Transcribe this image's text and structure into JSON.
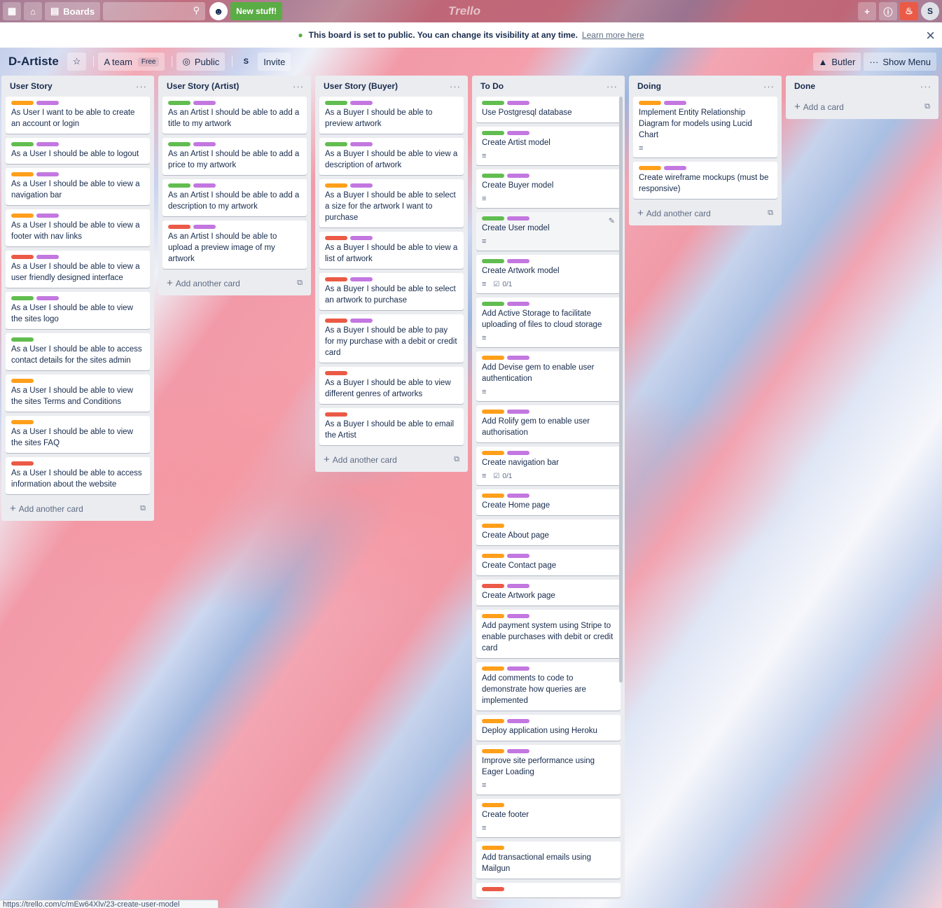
{
  "topbar": {
    "boards_label": "Boards",
    "new_stuff_label": "New stuff!",
    "logo_text": "Trello",
    "avatar_initial": "S",
    "icons": [
      "apps-icon",
      "home-icon",
      "boards-icon",
      "search-icon",
      "plus-icon",
      "info-icon",
      "bell-icon"
    ]
  },
  "banner": {
    "message": "This board is set to public. You can change its visibility at any time.",
    "link": "Learn more here"
  },
  "board_header": {
    "title": "D-Artiste",
    "team": "A team",
    "team_badge": "Free",
    "visibility": "Public",
    "member_initial": "S",
    "invite": "Invite",
    "butler": "Butler",
    "show_menu": "Show Menu"
  },
  "colors": {
    "green": "#61bd4f",
    "purple": "#c377e0",
    "orange": "#ff9f1a",
    "red": "#eb5a46"
  },
  "lists": [
    {
      "title": "User Story",
      "add_label": "Add another card",
      "cards": [
        {
          "labels": [
            "orange",
            "purple"
          ],
          "title": "As User I want to be able to create an account or login"
        },
        {
          "labels": [
            "green",
            "purple"
          ],
          "title": "As a User I should be able to logout"
        },
        {
          "labels": [
            "orange",
            "purple"
          ],
          "title": "As a User I should be able to view a navigation bar"
        },
        {
          "labels": [
            "orange",
            "purple"
          ],
          "title": "As a User I should be able to view a footer with nav links"
        },
        {
          "labels": [
            "red",
            "purple"
          ],
          "title": "As a User I should be able to view a user friendly designed interface"
        },
        {
          "labels": [
            "green",
            "purple"
          ],
          "title": "As a User I should be able to view the sites logo"
        },
        {
          "labels": [
            "green"
          ],
          "title": "As a User I should be able to access contact details for the sites admin"
        },
        {
          "labels": [
            "orange"
          ],
          "title": "As a User I should be able to view the sites Terms and Conditions"
        },
        {
          "labels": [
            "orange"
          ],
          "title": "As a User I should be able to view the sites FAQ"
        },
        {
          "labels": [
            "red"
          ],
          "title": "As a User I should be able to access information about the website"
        }
      ]
    },
    {
      "title": "User Story (Artist)",
      "add_label": "Add another card",
      "cards": [
        {
          "labels": [
            "green",
            "purple"
          ],
          "title": "As an Artist I should be able to add a title to my artwork"
        },
        {
          "labels": [
            "green",
            "purple"
          ],
          "title": "As an Artist I should be able to add a price to my artwork"
        },
        {
          "labels": [
            "green",
            "purple"
          ],
          "title": "As an Artist I should be able to add a description to my artwork"
        },
        {
          "labels": [
            "red",
            "purple"
          ],
          "title": "As an Artist I should be able to upload a preview image of my artwork"
        }
      ]
    },
    {
      "title": "User Story (Buyer)",
      "add_label": "Add another card",
      "cards": [
        {
          "labels": [
            "green",
            "purple"
          ],
          "title": "As a Buyer I should be able to preview artwork"
        },
        {
          "labels": [
            "green",
            "purple"
          ],
          "title": "As a Buyer I should be able to view a description of artwork"
        },
        {
          "labels": [
            "orange",
            "purple"
          ],
          "title": "As a Buyer I should be able to select a size for the artwork I want to purchase"
        },
        {
          "labels": [
            "red",
            "purple"
          ],
          "title": "As a Buyer I should be able to view a list of artwork"
        },
        {
          "labels": [
            "red",
            "purple"
          ],
          "title": "As a Buyer I should be able to select an artwork to purchase"
        },
        {
          "labels": [
            "red",
            "purple"
          ],
          "title": "As a Buyer I should be able to pay for my purchase with a debit or credit card"
        },
        {
          "labels": [
            "red"
          ],
          "title": "As a Buyer I should be able to view different genres of artworks"
        },
        {
          "labels": [
            "red"
          ],
          "title": "As a Buyer I should be able to email the Artist"
        }
      ]
    },
    {
      "title": "To Do",
      "cards": [
        {
          "labels": [
            "green",
            "purple"
          ],
          "title": "Use Postgresql database"
        },
        {
          "labels": [
            "green",
            "purple"
          ],
          "title": "Create Artist model",
          "desc": true
        },
        {
          "labels": [
            "green",
            "purple"
          ],
          "title": "Create Buyer model",
          "desc": true
        },
        {
          "labels": [
            "green",
            "purple"
          ],
          "title": "Create User model",
          "desc": true,
          "hover": true
        },
        {
          "labels": [
            "green",
            "purple"
          ],
          "title": "Create Artwork model",
          "desc": true,
          "checklist": "0/1"
        },
        {
          "labels": [
            "green",
            "purple"
          ],
          "title": "Add Active Storage to facilitate uploading of files to cloud storage",
          "desc": true
        },
        {
          "labels": [
            "orange",
            "purple"
          ],
          "title": "Add Devise gem to enable user authentication",
          "desc": true
        },
        {
          "labels": [
            "orange",
            "purple"
          ],
          "title": "Add Rolify gem to enable user authorisation"
        },
        {
          "labels": [
            "orange",
            "purple"
          ],
          "title": "Create navigation bar",
          "desc": true,
          "checklist": "0/1"
        },
        {
          "labels": [
            "orange",
            "purple"
          ],
          "title": "Create Home page"
        },
        {
          "labels": [
            "orange"
          ],
          "title": "Create About page"
        },
        {
          "labels": [
            "orange",
            "purple"
          ],
          "title": "Create Contact page"
        },
        {
          "labels": [
            "red",
            "purple"
          ],
          "title": "Create Artwork page"
        },
        {
          "labels": [
            "orange",
            "purple"
          ],
          "title": "Add payment system using Stripe to enable purchases with debit or credit card"
        },
        {
          "labels": [
            "orange",
            "purple"
          ],
          "title": "Add comments to code to demonstrate how queries are implemented"
        },
        {
          "labels": [
            "orange",
            "purple"
          ],
          "title": "Deploy application using Heroku"
        },
        {
          "labels": [
            "orange",
            "purple"
          ],
          "title": "Improve site performance using Eager Loading",
          "desc": true
        },
        {
          "labels": [
            "orange"
          ],
          "title": "Create footer",
          "desc": true
        },
        {
          "labels": [
            "orange"
          ],
          "title": "Add transactional emails using Mailgun"
        },
        {
          "labels": [
            "red"
          ],
          "title": ""
        }
      ]
    },
    {
      "title": "Doing",
      "add_label": "Add another card",
      "cards": [
        {
          "labels": [
            "orange",
            "purple"
          ],
          "title": "Implement Entity Relationship Diagram for models using Lucid Chart",
          "desc": true
        },
        {
          "labels": [
            "orange",
            "purple"
          ],
          "title": "Create wireframe mockups (must be responsive)"
        }
      ]
    },
    {
      "title": "Done",
      "add_label": "Add a card",
      "cards": []
    }
  ],
  "statusbar": {
    "url": "https://trello.com/c/mEw64Xlv/23-create-user-model"
  }
}
